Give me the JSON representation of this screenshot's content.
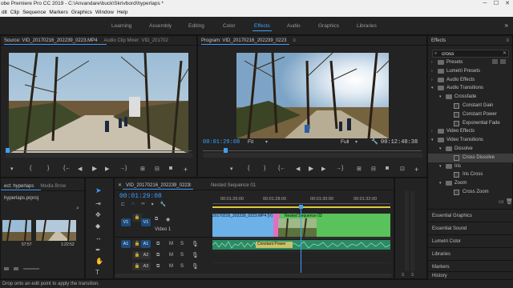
{
  "titlebar": {
    "title": "obe Premiere Pro CC 2019 - C:\\Anvandare\\buck\\Skrivbord\\hyperlaps *"
  },
  "menu": [
    "dit",
    "Clip",
    "Sequence",
    "Markers",
    "Graphics",
    "Window",
    "Help"
  ],
  "workspaces": [
    "Learning",
    "Assembly",
    "Editing",
    "Color",
    "Effects",
    "Audio",
    "Graphics",
    "Libraries"
  ],
  "workspaces_more": "»",
  "source": {
    "tab": "Source: VID_20170216_202239_0223.MP4",
    "tab2": "Audio Clip Mixer: VID_201702",
    "menu_icon": "≡"
  },
  "program": {
    "tab": "Program: VID_20170216_202239_0223",
    "menu_icon": "≡",
    "timecode": "00:01:29:08",
    "fit": "Fit",
    "quality": "Full",
    "duration": "00:12:40:38"
  },
  "effects": {
    "title": "Effects",
    "menu_icon": "≡",
    "search_value": "cross",
    "tree": [
      {
        "label": "Presets",
        "level": 0,
        "type": "folder",
        "open": false,
        "selected": false
      },
      {
        "label": "Lumetri Presets",
        "level": 0,
        "type": "folder",
        "open": false,
        "selected": false
      },
      {
        "label": "Audio Effects",
        "level": 0,
        "type": "folder",
        "open": false,
        "selected": false
      },
      {
        "label": "Audio Transitions",
        "level": 0,
        "type": "folder",
        "open": true,
        "selected": false
      },
      {
        "label": "Crossfade",
        "level": 1,
        "type": "folder",
        "open": true,
        "selected": false
      },
      {
        "label": "Constant Gain",
        "level": 2,
        "type": "fx",
        "open": false,
        "selected": false
      },
      {
        "label": "Constant Power",
        "level": 2,
        "type": "fx",
        "open": false,
        "selected": false
      },
      {
        "label": "Exponential Fade",
        "level": 2,
        "type": "fx",
        "open": false,
        "selected": false
      },
      {
        "label": "Video Effects",
        "level": 0,
        "type": "folder",
        "open": false,
        "selected": false
      },
      {
        "label": "Video Transitions",
        "level": 0,
        "type": "folder",
        "open": true,
        "selected": false
      },
      {
        "label": "Dissolve",
        "level": 1,
        "type": "folder",
        "open": true,
        "selected": false
      },
      {
        "label": "Cross Dissolve",
        "level": 2,
        "type": "fx",
        "open": false,
        "selected": true
      },
      {
        "label": "Iris",
        "level": 1,
        "type": "folder",
        "open": true,
        "selected": false
      },
      {
        "label": "Iris Cross",
        "level": 2,
        "type": "fx",
        "open": false,
        "selected": false
      },
      {
        "label": "Zoom",
        "level": 1,
        "type": "folder",
        "open": true,
        "selected": false
      },
      {
        "label": "Cross Zoom",
        "level": 2,
        "type": "fx",
        "open": false,
        "selected": false
      }
    ],
    "side_tabs": [
      "Essential Graphics",
      "Essential Sound",
      "Lumetri Color",
      "Libraries",
      "Markers",
      "History"
    ]
  },
  "project": {
    "tab": "ect: hyperlaps",
    "tab2": "Media Brow",
    "filename": "hyperlaps.prproj",
    "thumbs": [
      {
        "dur": "57:57"
      },
      {
        "dur": "1:22:52"
      }
    ]
  },
  "timeline": {
    "tab": "VID_20170216_202239_0223",
    "tab2": "Nested Sequence 01",
    "menu_icon": "≡",
    "timecode": "00:01:29:08",
    "ruler": [
      "00:01:26:00",
      "00:01:28:00",
      "00:01:30:00",
      "00:01:32:00"
    ],
    "tracks_video": [
      {
        "name": "V1",
        "label": "V1",
        "sub": "Video 1"
      },
      {
        "name": "V1-source",
        "label": "V1"
      }
    ],
    "tracks_audio": [
      {
        "src": "A1",
        "label": "A1",
        "m": "M",
        "s": "S"
      },
      {
        "label": "A2",
        "m": "M",
        "s": "S"
      },
      {
        "label": "A3",
        "m": "M",
        "s": "S"
      }
    ],
    "clip_v1": "20170216_202239_0223.MP4 [V]",
    "clip_nested": "Nested Sequence 03",
    "clip_constant": "Constant Power"
  },
  "status": "Drop onto an edit point to apply the transition.",
  "colors": {
    "accent": "#3ea0ff",
    "clip_video": "#6cb1e8",
    "clip_nested": "#59c25a",
    "clip_audio": "#2d8a64",
    "pink": "#e06fc2"
  }
}
